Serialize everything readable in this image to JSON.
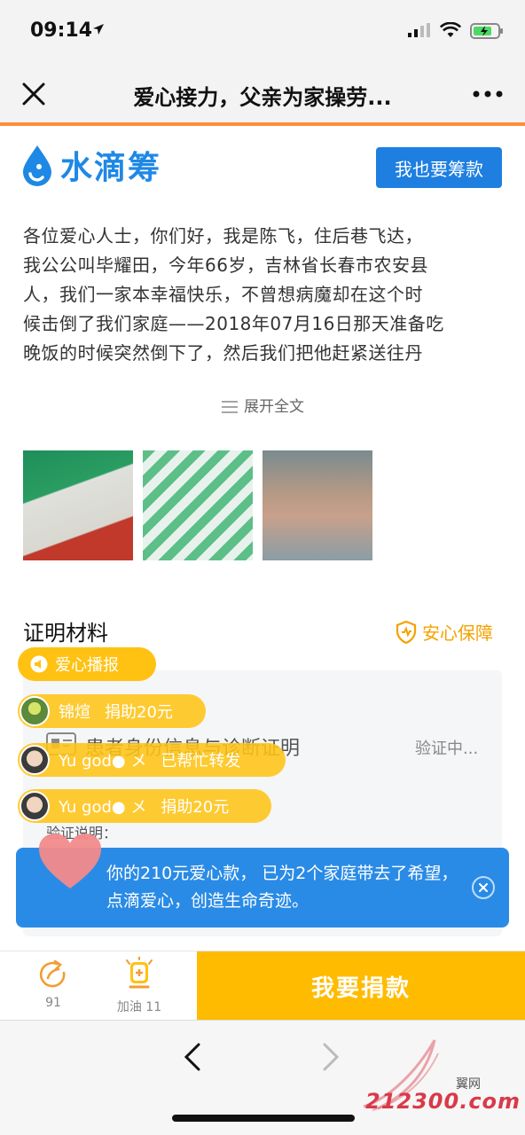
{
  "status_bar": {
    "time": "09:14"
  },
  "nav": {
    "title": "爱心接力，父亲为家操劳..."
  },
  "header": {
    "logo_text": "水滴筹",
    "raise_button": "我也要筹款"
  },
  "story": {
    "lines": [
      "各位爱心人士，你们好，我是陈飞，住后巷飞达，",
      "我公公叫毕耀田，今年66岁，吉林省长春市农安县",
      "人，我们一家本幸福快乐，不曾想病魔却在这个时",
      "候击倒了我们家庭——2018年07月16日那天准备吃",
      "晚饭的时候突然倒下了，然后我们把他赶紧送往丹"
    ],
    "expand_label": "展开全文"
  },
  "proof": {
    "title": "证明材料",
    "safe_label": "安心保障",
    "doc_title": "患者身份信息与诊断证明",
    "doc_status": "验证中...",
    "desc_label": "验证说明："
  },
  "broadcast": {
    "label": "爱心播报",
    "items": [
      {
        "name": "锦煊",
        "action": "捐助20元"
      },
      {
        "name": "Yu god● メ",
        "action": "已帮忙转发"
      },
      {
        "name": "Yu god● メ",
        "action": "捐助20元"
      }
    ]
  },
  "toast": {
    "text": "你的210元爱心款， 已为2个家庭带去了希望，点滴爱心，创造生命奇迹。"
  },
  "action_bar": {
    "share_count": "91",
    "cheer_label": "加油 11",
    "donate_label": "我要捐款"
  },
  "watermark": {
    "text": "212300.com",
    "small": "翼网"
  },
  "colors": {
    "accent": "#ffbb00",
    "brand_blue": "#1e7fe0",
    "toast_blue": "#2a8be6",
    "nav_divider": "#ff8c3a"
  }
}
